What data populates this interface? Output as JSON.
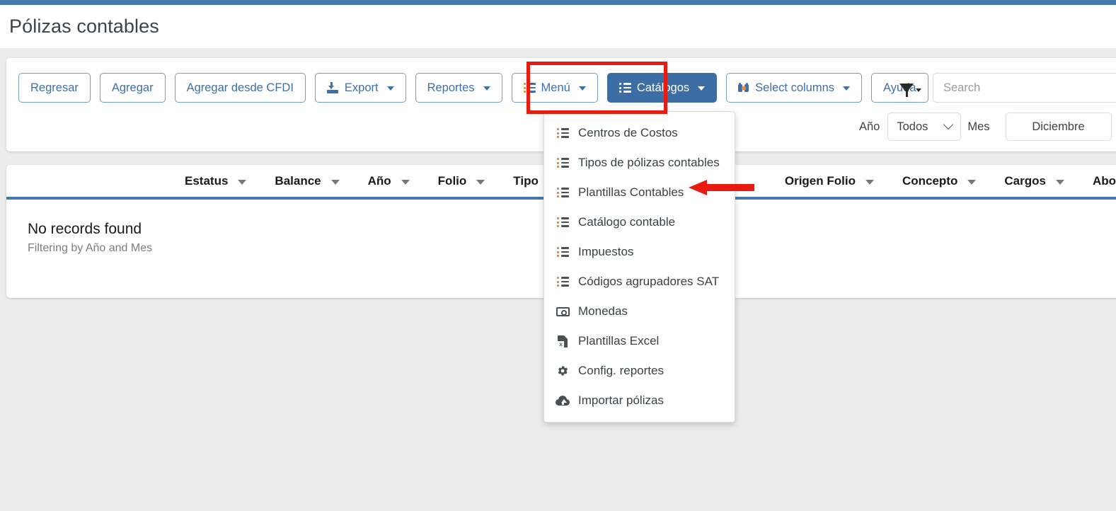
{
  "page": {
    "title": "Pólizas contables",
    "accent_color": "#4678b0",
    "primary_button_color": "#3c6ea5",
    "annotation_color": "#e81b11"
  },
  "toolbar": {
    "buttons": [
      {
        "label": "Regresar",
        "icon": null,
        "caret": false,
        "active": false
      },
      {
        "label": "Agregar",
        "icon": null,
        "caret": false,
        "active": false
      },
      {
        "label": "Agregar desde CFDI",
        "icon": null,
        "caret": false,
        "active": false
      },
      {
        "label": "Export",
        "icon": "export-icon",
        "caret": true,
        "active": false
      },
      {
        "label": "Reportes",
        "icon": null,
        "caret": true,
        "active": false
      },
      {
        "label": "Menú",
        "icon": "list-icon",
        "caret": true,
        "active": false
      },
      {
        "label": "Catálogos",
        "icon": "list-icon",
        "caret": true,
        "active": true
      },
      {
        "label": "Select columns",
        "icon": "puzzle-icon",
        "caret": true,
        "active": false
      },
      {
        "label": "Ayuda",
        "icon": null,
        "caret": false,
        "active": false
      }
    ]
  },
  "filters": {
    "funnel_icon": "filter-funnel-icon",
    "search_placeholder": "Search",
    "search_value": "",
    "anio_label": "Año",
    "anio_value": "Todos",
    "mes_label": "Mes",
    "mes_value": "Diciembre"
  },
  "dropdown": {
    "open": true,
    "owner": "Catálogos",
    "items": [
      {
        "label": "Centros de Costos",
        "icon": "list-icon"
      },
      {
        "label": "Tipos de pólizas contables",
        "icon": "list-icon"
      },
      {
        "label": "Plantillas Contables",
        "icon": "list-icon"
      },
      {
        "label": "Catálogo contable",
        "icon": "list-icon"
      },
      {
        "label": "Impuestos",
        "icon": "list-icon"
      },
      {
        "label": "Códigos agrupadores SAT",
        "icon": "list-icon"
      },
      {
        "label": "Monedas",
        "icon": "money-icon"
      },
      {
        "label": "Plantillas Excel",
        "icon": "excel-file-icon"
      },
      {
        "label": "Config. reportes",
        "icon": "gear-icon"
      },
      {
        "label": "Importar pólizas",
        "icon": "cloud-upload-icon"
      }
    ]
  },
  "table": {
    "columns": [
      {
        "label": "Estatus",
        "sortable": true
      },
      {
        "label": "Balance",
        "sortable": true
      },
      {
        "label": "Año",
        "sortable": true
      },
      {
        "label": "Folio",
        "sortable": true
      },
      {
        "label": "Tipo",
        "sortable": true
      },
      {
        "label": "",
        "sortable": true
      },
      {
        "label": "Origen Folio",
        "sortable": true
      },
      {
        "label": "Concepto",
        "sortable": true
      },
      {
        "label": "Cargos",
        "sortable": true
      },
      {
        "label": "Abonos",
        "sortable": false
      }
    ],
    "rows": [],
    "empty_title": "No records found",
    "empty_subtitle": "Filtering by Año and Mes"
  },
  "annotations": {
    "highlight_target": "Catálogos",
    "arrow_target": "Plantillas Contables"
  }
}
